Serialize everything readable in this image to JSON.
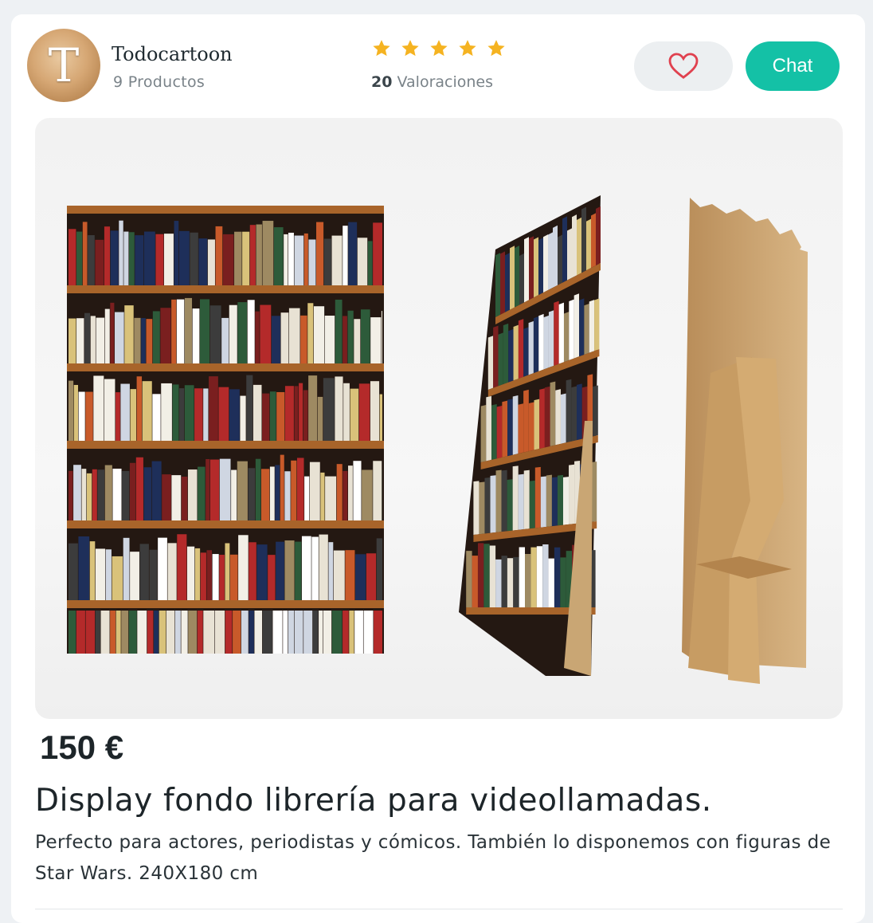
{
  "seller": {
    "avatar_letter": "T",
    "name": "Todocartoon",
    "products": "9 Productos",
    "rating_stars": 5,
    "rating_count": "20",
    "rating_label": "Valoraciones"
  },
  "actions": {
    "favorite_icon": "heart-icon",
    "chat_label": "Chat"
  },
  "product": {
    "image_icon": "bookshelf-display-photo",
    "price": "150 €",
    "title": "Display fondo librería para videollamadas.",
    "description": "Perfecto para actores, periodistas y cómicos. También lo disponemos con figuras de Star Wars. 240X180 cm"
  },
  "colors": {
    "accent": "#14c1a6",
    "star": "#f5b321",
    "heart": "#e0414f"
  }
}
